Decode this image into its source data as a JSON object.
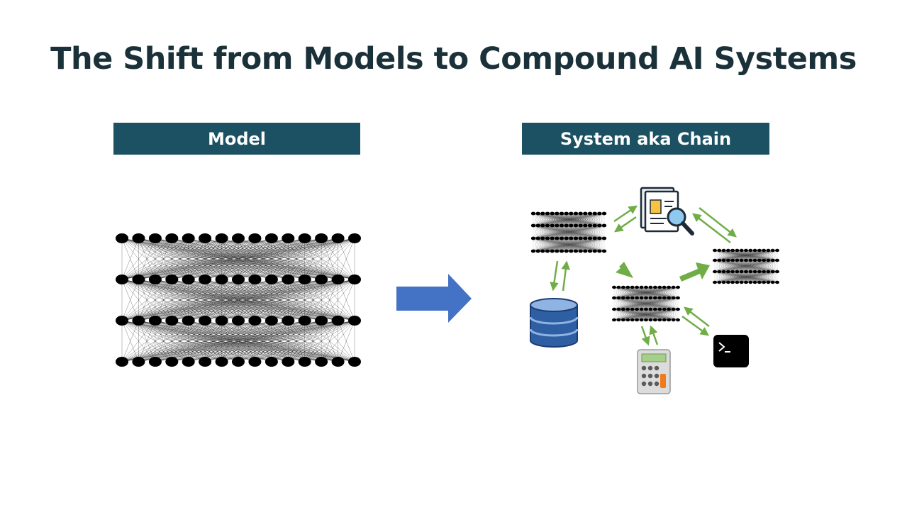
{
  "slide": {
    "title": "The Shift from Models to Compound AI Systems",
    "left_label": "Model",
    "right_label": "System aka Chain"
  },
  "colors": {
    "title_text": "#1b3139",
    "label_bg": "#1b5162",
    "label_text": "#ffffff",
    "big_arrow": "#4472c4",
    "flow_arrows": "#70ad47",
    "network": "#000000",
    "database": "#2f5fa3",
    "terminal_bg": "#000000"
  },
  "diagram": {
    "model_network": {
      "icon": "neural-network",
      "layers": 4,
      "nodes_per_layer": 15
    },
    "system_components": [
      {
        "id": "llm-a",
        "icon": "neural-network"
      },
      {
        "id": "llm-b",
        "icon": "neural-network"
      },
      {
        "id": "llm-c",
        "icon": "neural-network"
      },
      {
        "id": "retriever",
        "icon": "document-search-icon"
      },
      {
        "id": "database",
        "icon": "database-icon"
      },
      {
        "id": "calculator",
        "icon": "calculator-icon"
      },
      {
        "id": "terminal",
        "icon": "terminal-icon"
      }
    ],
    "transition_arrow": "right-arrow"
  }
}
